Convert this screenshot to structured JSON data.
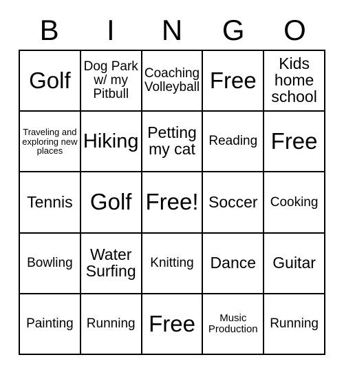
{
  "header": {
    "letters": [
      "B",
      "I",
      "N",
      "G",
      "O"
    ]
  },
  "grid": {
    "rows": [
      [
        {
          "text": "Golf",
          "size": "xl"
        },
        {
          "text": "Dog Park w/ my Pitbull",
          "size": "sm"
        },
        {
          "text": "Coaching Volleyball",
          "size": "sm"
        },
        {
          "text": "Free",
          "size": "xl"
        },
        {
          "text": "Kids home school",
          "size": "md"
        }
      ],
      [
        {
          "text": "Traveling and exploring new places",
          "size": "xxs"
        },
        {
          "text": "Hiking",
          "size": "lg"
        },
        {
          "text": "Petting my cat",
          "size": "md"
        },
        {
          "text": "Reading",
          "size": "sm"
        },
        {
          "text": "Free",
          "size": "xl"
        }
      ],
      [
        {
          "text": "Tennis",
          "size": "md"
        },
        {
          "text": "Golf",
          "size": "xl"
        },
        {
          "text": "Free!",
          "size": "xl"
        },
        {
          "text": "Soccer",
          "size": "md"
        },
        {
          "text": "Cooking",
          "size": "sm"
        }
      ],
      [
        {
          "text": "Bowling",
          "size": "sm"
        },
        {
          "text": "Water Surfing",
          "size": "md"
        },
        {
          "text": "Knitting",
          "size": "sm"
        },
        {
          "text": "Dance",
          "size": "md"
        },
        {
          "text": "Guitar",
          "size": "md"
        }
      ],
      [
        {
          "text": "Painting",
          "size": "sm"
        },
        {
          "text": "Running",
          "size": "sm"
        },
        {
          "text": "Free",
          "size": "xl"
        },
        {
          "text": "Music Production",
          "size": "xs"
        },
        {
          "text": "Running",
          "size": "sm"
        }
      ]
    ]
  },
  "colors": {
    "background": "#ffffff",
    "text": "#000000",
    "border": "#000000"
  }
}
